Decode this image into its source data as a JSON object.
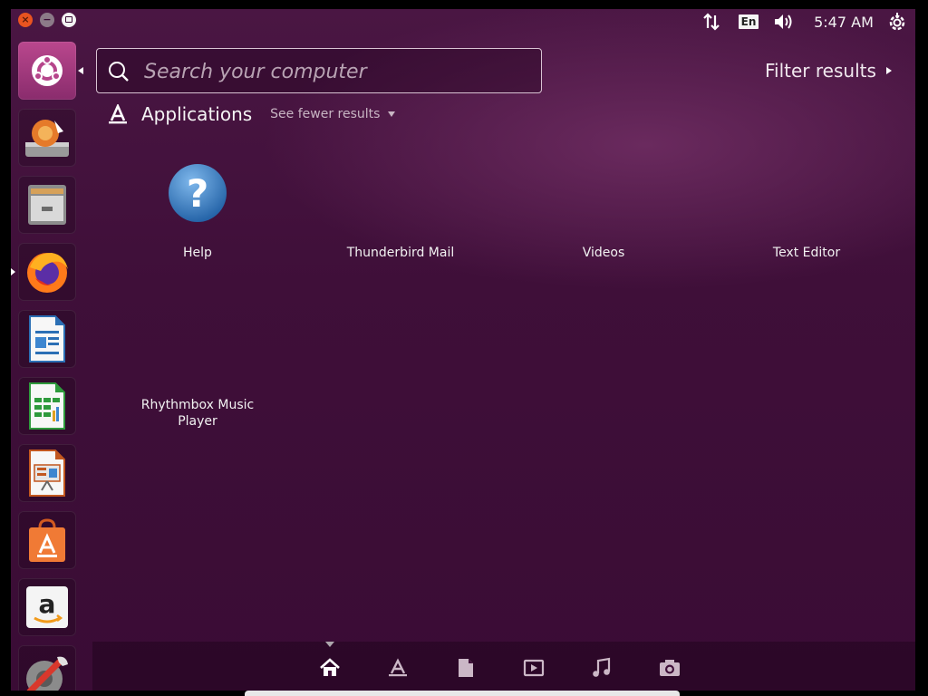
{
  "window_controls": {
    "close": "×",
    "minimize": "−",
    "maximize": ""
  },
  "top_panel": {
    "language": "En",
    "time": "5:47 AM"
  },
  "launcher": {
    "items": [
      {
        "name": "dash-home",
        "icon": "ubuntu-logo-icon"
      },
      {
        "name": "system-update",
        "icon": "software-updater-icon"
      },
      {
        "name": "files",
        "icon": "file-cabinet-icon"
      },
      {
        "name": "firefox",
        "icon": "firefox-icon"
      },
      {
        "name": "writer",
        "icon": "libreoffice-writer-icon"
      },
      {
        "name": "calc",
        "icon": "libreoffice-calc-icon"
      },
      {
        "name": "impress",
        "icon": "libreoffice-impress-icon"
      },
      {
        "name": "software-center",
        "icon": "ubuntu-software-icon"
      },
      {
        "name": "amazon",
        "icon": "amazon-icon"
      },
      {
        "name": "system-settings",
        "icon": "settings-wrench-icon"
      }
    ]
  },
  "search": {
    "placeholder": "Search your computer",
    "value": ""
  },
  "filter": {
    "label": "Filter results"
  },
  "category": {
    "title": "Applications",
    "toggle": "See fewer results"
  },
  "apps": [
    {
      "label": "Help"
    },
    {
      "label": "Thunderbird Mail"
    },
    {
      "label": "Videos"
    },
    {
      "label": "Text Editor"
    },
    {
      "label": "Rhythmbox Music Player"
    }
  ],
  "lenses": [
    {
      "name": "home",
      "icon": "home-icon",
      "active": true
    },
    {
      "name": "applications",
      "icon": "applications-icon"
    },
    {
      "name": "files",
      "icon": "document-icon"
    },
    {
      "name": "video",
      "icon": "video-icon"
    },
    {
      "name": "music",
      "icon": "music-note-icon"
    },
    {
      "name": "photos",
      "icon": "camera-icon"
    }
  ],
  "colors": {
    "background": "#3f0f39",
    "accent": "#e95420",
    "dash_tile": "#a23b7e"
  }
}
